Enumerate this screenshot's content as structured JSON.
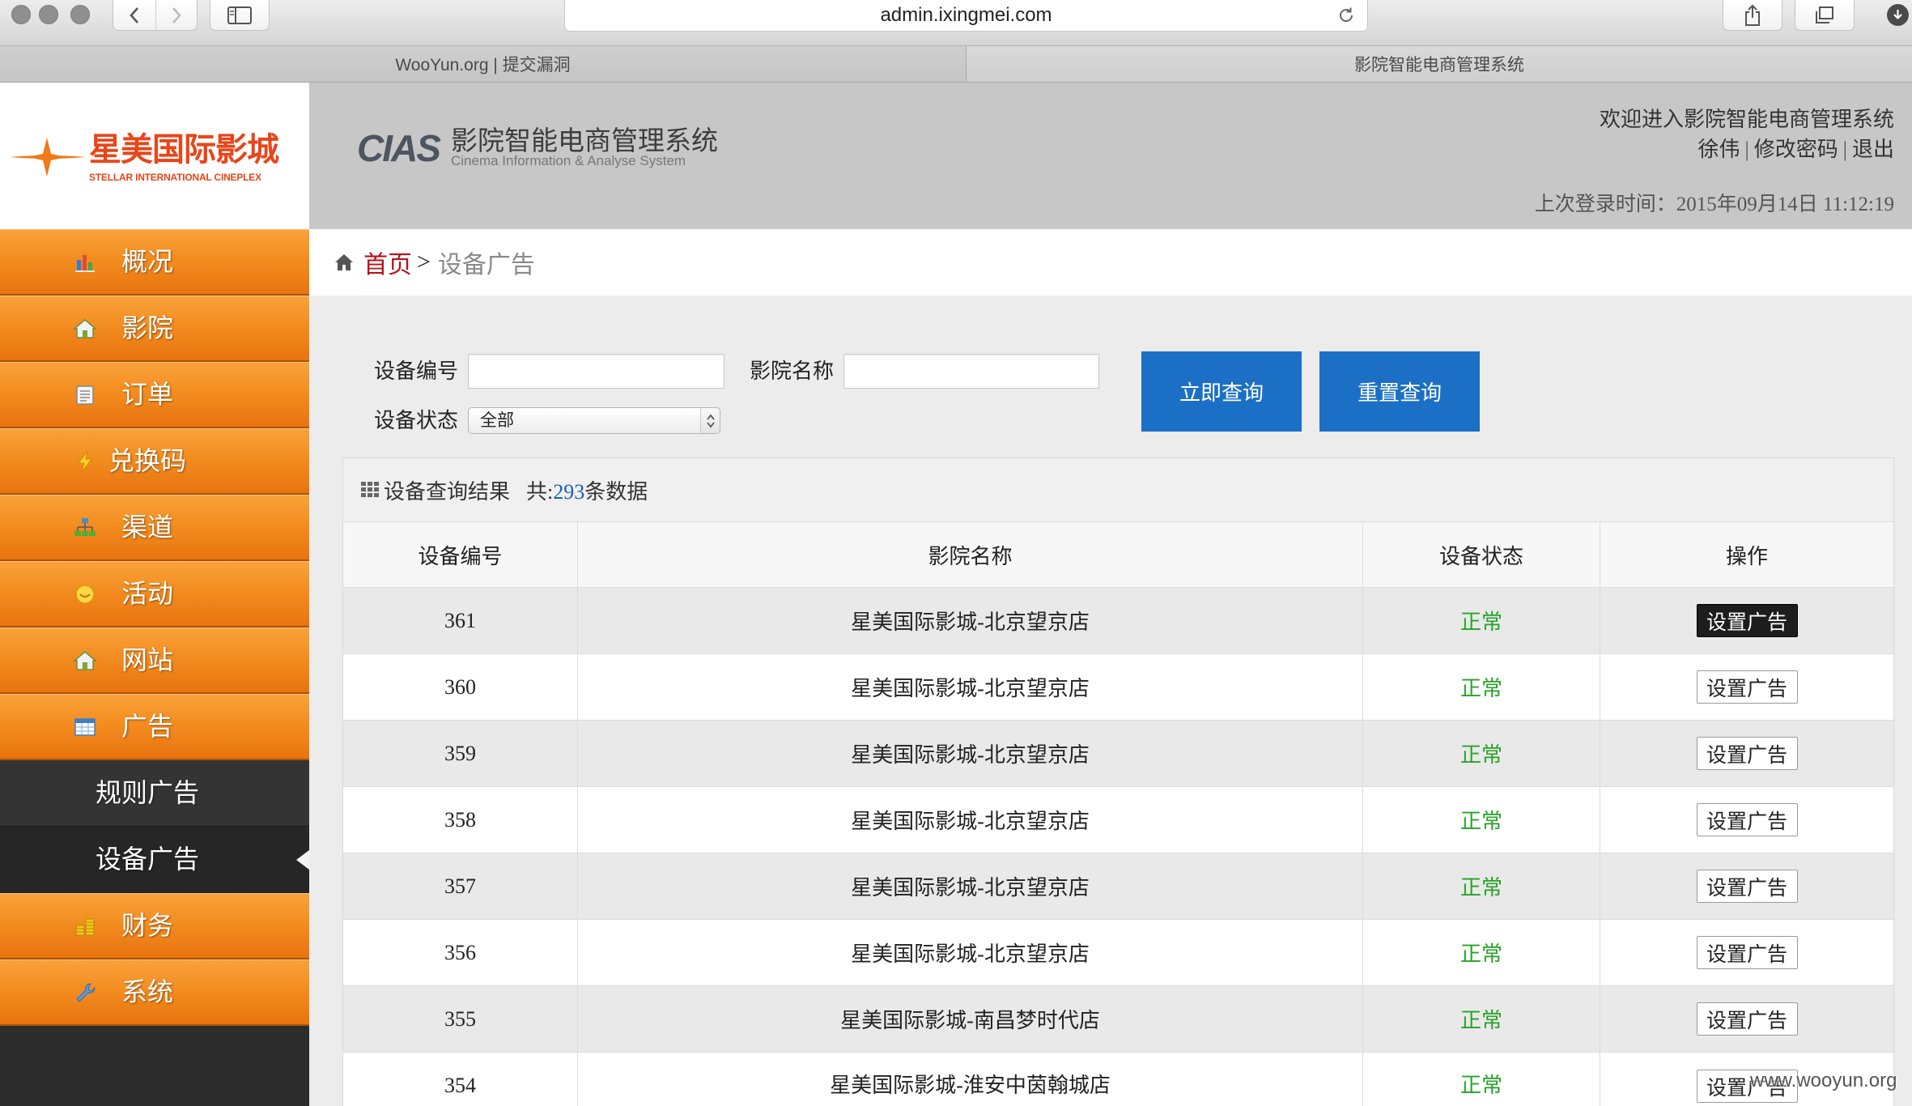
{
  "browser": {
    "url": "admin.ixingmei.com",
    "tabs": [
      {
        "label": "WooYun.org | 提交漏洞"
      },
      {
        "label": "影院智能电商管理系统"
      }
    ]
  },
  "header": {
    "brand_cn": "星美国际影城",
    "brand_en": "STELLAR INTERNATIONAL CINEPLEX",
    "system_mark": "CIAS",
    "system_name": "影院智能电商管理系统",
    "system_name_en": "Cinema Information & Analyse System",
    "welcome": "欢迎进入影院智能电商管理系统",
    "user_name": "徐伟",
    "separator": "|",
    "change_password": "修改密码",
    "logout": "退出",
    "last_login": "上次登录时间：2015年09月14日 11:12:19"
  },
  "sidebar": {
    "items": [
      {
        "label": "概况",
        "icon": "chart-icon",
        "type": "main"
      },
      {
        "label": "影院",
        "icon": "house-icon",
        "type": "main"
      },
      {
        "label": "订单",
        "icon": "document-icon",
        "type": "main"
      },
      {
        "label": "兑换码",
        "icon": "lightning-icon",
        "type": "main"
      },
      {
        "label": "渠道",
        "icon": "sitemap-icon",
        "type": "main"
      },
      {
        "label": "活动",
        "icon": "smiley-icon",
        "type": "main"
      },
      {
        "label": "网站",
        "icon": "house-icon",
        "type": "main"
      },
      {
        "label": "广告",
        "icon": "calendar-icon",
        "type": "main"
      },
      {
        "label": "规则广告",
        "type": "sub"
      },
      {
        "label": "设备广告",
        "type": "sub",
        "active": true
      },
      {
        "label": "财务",
        "icon": "coins-icon",
        "type": "main"
      },
      {
        "label": "系统",
        "icon": "wrench-icon",
        "type": "main"
      }
    ]
  },
  "breadcrumb": {
    "home": "首页",
    "separator": ">",
    "current": "设备广告"
  },
  "search": {
    "device_no_label": "设备编号",
    "device_no_value": "",
    "cinema_label": "影院名称",
    "cinema_value": "",
    "status_label": "设备状态",
    "status_selected": "全部",
    "query_button": "立即查询",
    "reset_button": "重置查询"
  },
  "results": {
    "title": "设备查询结果",
    "total_prefix": "共:",
    "total": "293",
    "total_suffix": "条数据",
    "columns": [
      "设备编号",
      "影院名称",
      "设备状态",
      "操作"
    ],
    "rows": [
      {
        "id": "361",
        "cinema": "星美国际影城-北京望京店",
        "status": "正常",
        "action": "设置广告",
        "action_highlighted": true
      },
      {
        "id": "360",
        "cinema": "星美国际影城-北京望京店",
        "status": "正常",
        "action": "设置广告"
      },
      {
        "id": "359",
        "cinema": "星美国际影城-北京望京店",
        "status": "正常",
        "action": "设置广告"
      },
      {
        "id": "358",
        "cinema": "星美国际影城-北京望京店",
        "status": "正常",
        "action": "设置广告"
      },
      {
        "id": "357",
        "cinema": "星美国际影城-北京望京店",
        "status": "正常",
        "action": "设置广告"
      },
      {
        "id": "356",
        "cinema": "星美国际影城-北京望京店",
        "status": "正常",
        "action": "设置广告"
      },
      {
        "id": "355",
        "cinema": "星美国际影城-南昌梦时代店",
        "status": "正常",
        "action": "设置广告"
      },
      {
        "id": "354",
        "cinema": "星美国际影城-淮安中茵翰城店",
        "status": "正常",
        "action": "设置广告"
      }
    ]
  },
  "colors": {
    "accent_orange": "#f28a1c",
    "button_blue": "#1b70c6",
    "status_ok": "#27a327",
    "brand_red": "#e8461a",
    "link_red": "#b5121b",
    "count_blue": "#1a5fb4"
  },
  "watermark": "www.wooyun.org"
}
